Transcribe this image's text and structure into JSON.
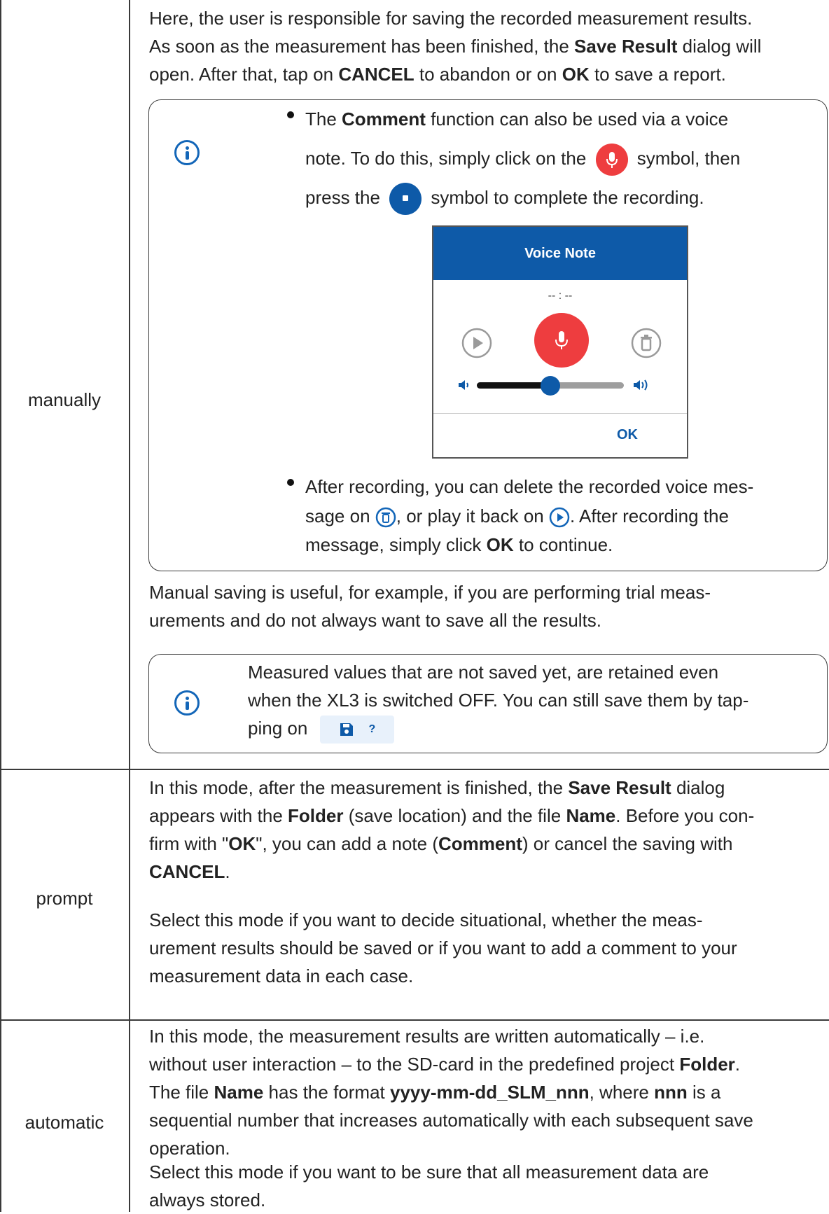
{
  "rows": {
    "manually": {
      "label": "manually",
      "intro": {
        "p1": "Here, the user is responsible for saving the recorded measurement results.",
        "p2a": "As soon as the measurement has been finished, the ",
        "p2b": "Save Result",
        "p2c": " dialog will",
        "p3a": "open. After that, tap on ",
        "p3b": "CANCEL",
        "p3c": " to abandon or on ",
        "p3d": "OK",
        "p3e": " to save a report."
      },
      "note1": {
        "b1_l1a": "The ",
        "b1_l1b": "Comment",
        "b1_l1c": " function can also be used via a voice",
        "b1_l2a": "note. To do this, simply click on the",
        "b1_l2b": "symbol, then",
        "b1_l3a": "press the",
        "b1_l3b": "symbol to complete the recording.",
        "b2_l1": "After recording, you can delete the recorded voice mes-",
        "b2_l2a": "sage on",
        "b2_l2b": ", or play it back on",
        "b2_l2c": ". After recording the",
        "b2_l3a": "message, simply click ",
        "b2_l3b": "OK",
        "b2_l3c": " to continue."
      },
      "voice_dialog": {
        "title": "Voice Note",
        "time": "-- : --",
        "ok": "OK",
        "volume_level": 0.5
      },
      "middle": {
        "l1": "Manual saving is useful, for example, if you are performing trial meas-",
        "l2": "urements and do not always want to save all the results."
      },
      "note2": {
        "l1": "Measured values that are not saved yet, are retained even",
        "l2": "when the XL3 is switched OFF. You can still save them by tap-",
        "l3": "ping on",
        "chip_q": "?"
      }
    },
    "prompt": {
      "label": "prompt",
      "p1_l1a": "In this mode, after the measurement is finished, the ",
      "p1_l1b": "Save Result",
      "p1_l1c": " dialog",
      "p1_l2a": "appears with the ",
      "p1_l2b": "Folder",
      "p1_l2c": " (save location) and the file ",
      "p1_l2d": "Name",
      "p1_l2e": ". Before you con-",
      "p1_l3a": "firm with \"",
      "p1_l3b": "OK",
      "p1_l3c": "\", you can add a note (",
      "p1_l3d": "Comment",
      "p1_l3e": ") or cancel the saving with",
      "p1_l4": "CANCEL",
      "p1_l4b": ".",
      "p2_l1": "Select this mode if you want to decide situational, whether the meas-",
      "p2_l2": "urement results should be saved or if you want to add a comment to your",
      "p2_l3": "measurement data in each case."
    },
    "automatic": {
      "label": "automatic",
      "l1": "In this mode, the measurement results are written automatically – i.e.",
      "l2a": "without user interaction – to the SD-card in the predefined project ",
      "l2b": "Folder",
      "l2c": ".",
      "l3a": "The file ",
      "l3b": "Name",
      "l3c": " has the format ",
      "l3d": "yyyy-mm-dd_SLM_nnn",
      "l3e": ", where ",
      "l3f": "nnn",
      "l3g": " is a",
      "l4": "sequential number that increases automatically with each subsequent save",
      "l5": "operation.",
      "p2_l1": "Select this mode if you want to be sure that all measurement data are",
      "p2_l2": "always stored."
    }
  },
  "icons": {
    "info": "info-icon",
    "mic": "microphone-icon",
    "stop": "stop-icon",
    "play": "play-icon",
    "delete": "trash-icon",
    "volume_low": "volume-low-icon",
    "volume_high": "volume-high-icon",
    "save": "floppy-disk-icon"
  },
  "colors": {
    "accent_blue": "#0e5aa8",
    "record_red": "#ee3d3f",
    "info_blue": "#1366b8"
  }
}
